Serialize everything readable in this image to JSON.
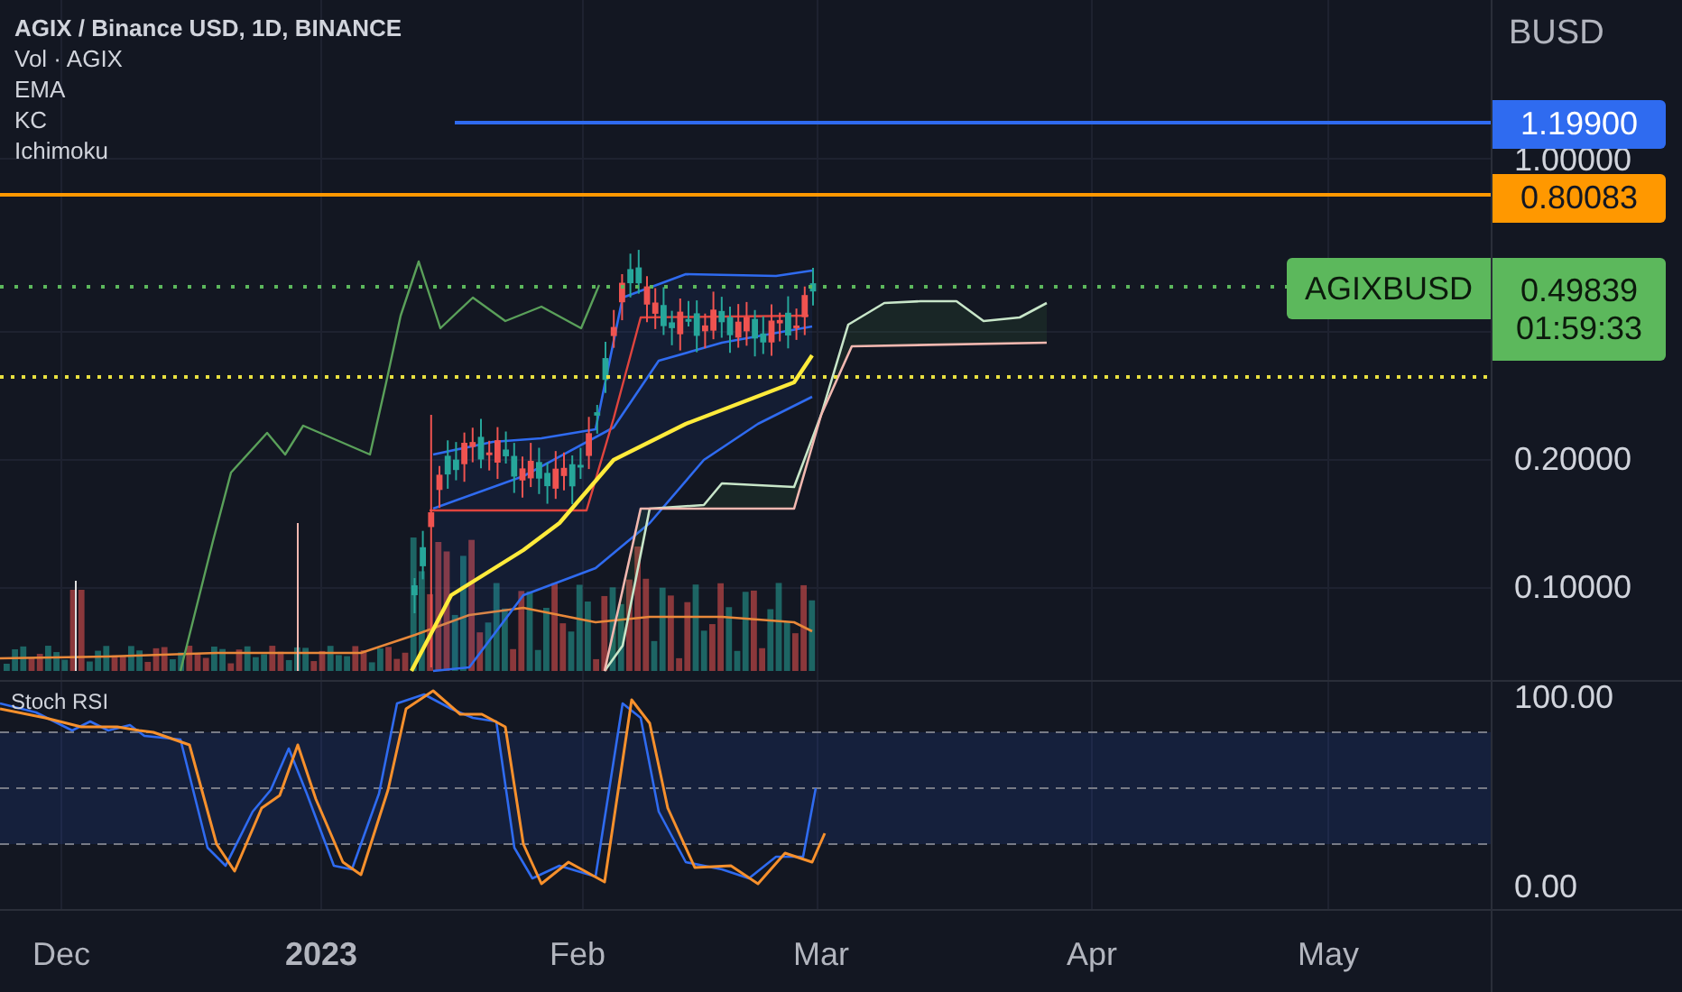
{
  "legend": [
    {
      "text": "AGIX / Binance USD, 1D, BINANCE",
      "kind": "title"
    },
    {
      "text": "Vol · AGIX",
      "kind": "study"
    },
    {
      "text": "EMA",
      "kind": "study"
    },
    {
      "text": "KC",
      "kind": "study"
    },
    {
      "text": "Ichimoku",
      "kind": "study"
    }
  ],
  "price_axis": {
    "unit": "BUSD",
    "labels": [
      "1.00000",
      "0.20000",
      "0.10000"
    ]
  },
  "price_lines": [
    {
      "price": "1.19900",
      "color": "#2f6bf0"
    },
    {
      "price": "0.80083",
      "color": "#ff9800"
    }
  ],
  "last_price": {
    "symbol": "AGIXBUSD",
    "price": "0.49839",
    "countdown": "01:59:33",
    "color": "#5cb85c"
  },
  "stoch_pane": {
    "title": "Stoch RSI",
    "axis_labels": [
      "100.00",
      "0.00"
    ]
  },
  "time_axis": [
    {
      "label": "Dec",
      "bold": false
    },
    {
      "label": "2023",
      "bold": true
    },
    {
      "label": "Feb",
      "bold": false
    },
    {
      "label": "Mar",
      "bold": false
    },
    {
      "label": "Apr",
      "bold": false
    },
    {
      "label": "May",
      "bold": false
    }
  ]
}
